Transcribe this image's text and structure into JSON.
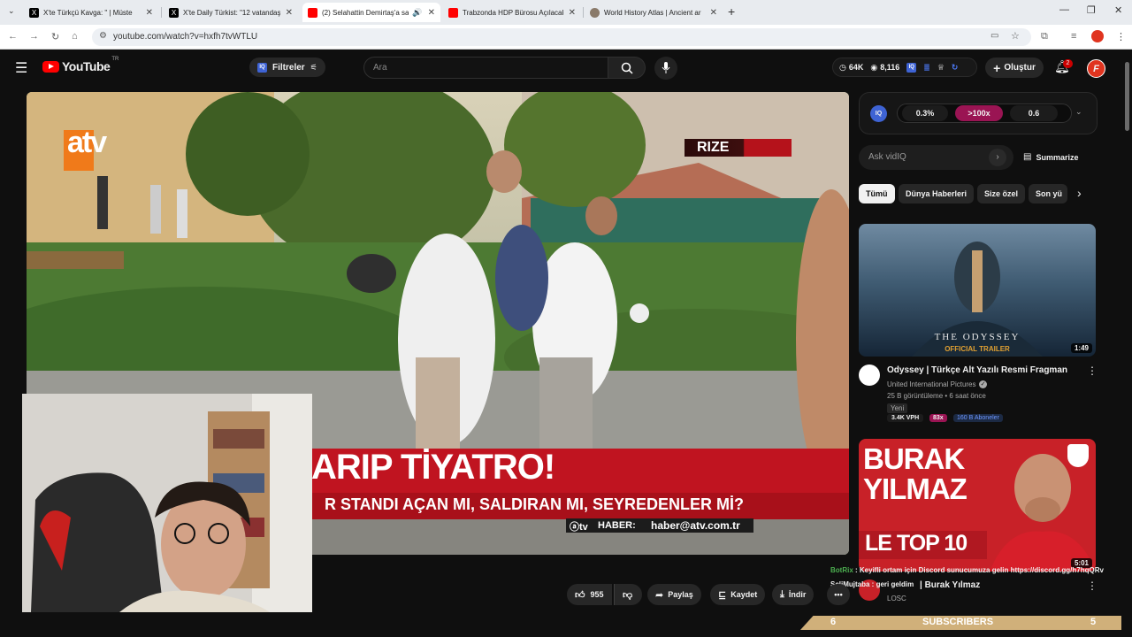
{
  "browser": {
    "tabs": [
      {
        "title": "X'te Türkçü Kavga: \" | Müste",
        "favicon": "x-icon",
        "active": false
      },
      {
        "title": "X'te Daily Türkist: \"12 vatandaş",
        "favicon": "x-icon",
        "active": false
      },
      {
        "title": "(2) Selahattin Demirtaş'a sa",
        "favicon": "youtube-icon",
        "active": true
      },
      {
        "title": "Trabzonda HDP Bürosu Açılacak",
        "favicon": "youtube-icon",
        "active": false
      },
      {
        "title": "World History Atlas | Ancient ar",
        "favicon": "globe-icon",
        "active": false
      }
    ],
    "new_tab": "+",
    "url": "youtube.com/watch?v=hxfh7tvWTLU"
  },
  "youtube": {
    "logo_text": "YouTube",
    "country": "TR",
    "filters_label": "Filtreler",
    "search_placeholder": "Ara",
    "stats": {
      "views": "64K",
      "watching": "8,116"
    },
    "create_label": "Oluştur",
    "notif_count": "2",
    "avatar_letter": "F"
  },
  "video": {
    "channel_logo": "atv",
    "location_tag": "RIZE",
    "headline": "ARIP TİYATRO!",
    "subheadline": "R STANDI AÇAN MI, SALDIRAN MI, SEYREDENLER Mİ?",
    "news_email": "haber@atv.com.tr",
    "news_brand": "HABER:"
  },
  "iq": {
    "badge": "IQ",
    "pill1": "0.3%",
    "pill2": ">100x",
    "pill3": "0.6"
  },
  "ask": {
    "placeholder": "Ask vidIQ",
    "summarize": "Summarize"
  },
  "chips": [
    "Tümü",
    "Dünya Haberleri",
    "Size özel",
    "Son yü"
  ],
  "recommendations": [
    {
      "title": "Odyssey | Türkçe Alt Yazılı Resmi Fragman",
      "channel": "United International Pictures",
      "views": "25 B görüntüleme • 6 saat önce",
      "badge": "Yeni",
      "vph": "3.4K VPH",
      "score": "83x",
      "subs": "160 B Aboneler",
      "duration": "1:49",
      "thumb_title": "THE ODYSSEY",
      "thumb_sub": "OFFICIAL TRAILER"
    },
    {
      "title": "| Burak Yılmaz",
      "channel": "LOSC",
      "duration": "5:01",
      "thumb_name1": "BURAK",
      "thumb_name2": "YILMAZ",
      "thumb_caption": "LE TOP 10"
    }
  ],
  "chat": [
    {
      "user": "BotRix",
      "text": "Keyifli ortam için Discord sunucumuza gelin https://discord.gg/h7hqQRv"
    },
    {
      "user": "SeliMujtaba",
      "text": "geri geldim"
    }
  ],
  "actions": {
    "likes": "955",
    "share": "Paylaş",
    "save": "Kaydet",
    "download": "İndir"
  },
  "subs_bar": {
    "left": "6",
    "label": "SUBSCRIBERS",
    "right": "5"
  }
}
